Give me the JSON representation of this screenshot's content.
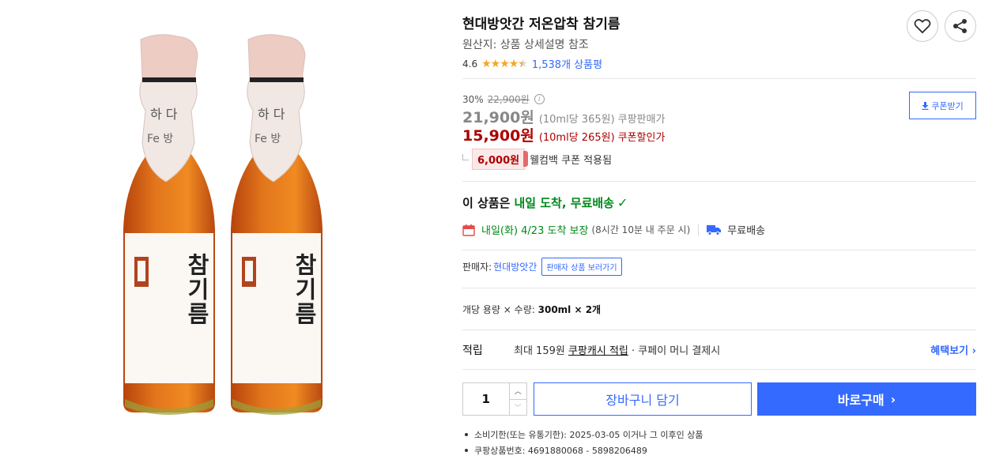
{
  "product": {
    "title": "현대방앗간 저온압착 참기름",
    "origin": "원산지: 상품 상세설명 참조",
    "rating_value": "4.6",
    "rating_stars": 4.5,
    "review_count": "1,538개 상품평",
    "image_label": "참기름"
  },
  "price": {
    "discount_rate": "30%",
    "original_price": "22,900원",
    "sale_price": "21,900원",
    "sale_unit": "(10ml당 365원)",
    "sale_label": "쿠팡판매가",
    "coupon_price": "15,900원",
    "coupon_unit": "(10ml당 265원)",
    "coupon_label": "쿠폰할인가",
    "coupon_button": "쿠폰받기",
    "cash_amount": "6,000원",
    "cash_text": "웰컴백 쿠폰 적용됨"
  },
  "delivery": {
    "head_prefix": "이 상품은",
    "head_green": "내일 도착, 무료배송",
    "arrival": "내일(화) 4/23 도착 보장",
    "arrival_note": "(8시간 10분 내 주문 시)",
    "free_shipping": "무료배송"
  },
  "seller": {
    "label": "판매자:",
    "name": "현대방앗간",
    "button": "판매자 상품 보러가기"
  },
  "option": {
    "label": "개당 용량 × 수량:",
    "value": "300ml × 2개"
  },
  "points": {
    "label": "적립",
    "prefix": "최대 159원",
    "link": "쿠팡캐시 적립",
    "suffix": " · 쿠페이 머니 결제시",
    "benefit": "혜택보기"
  },
  "purchase": {
    "quantity": "1",
    "cart": "장바구니 담기",
    "buy": "바로구매"
  },
  "notes": [
    "소비기한(또는 유통기한): 2025-03-05 이거나 그 이후인 상품",
    "쿠팡상품번호: 4691880068 - 5898206489"
  ],
  "colors": {
    "accent": "#346aff",
    "coupon_red": "#ae0000",
    "delivery_green": "#00891a",
    "star": "#f5a623"
  }
}
